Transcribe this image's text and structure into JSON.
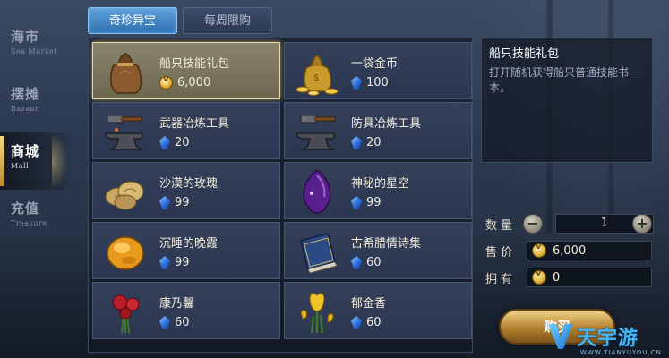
{
  "side_menu": [
    {
      "cn": "海市",
      "en": "Sea Market",
      "active": false
    },
    {
      "cn": "摆摊",
      "en": "Bazaar",
      "active": false
    },
    {
      "cn": "商城",
      "en": "Mall",
      "active": true
    },
    {
      "cn": "充值",
      "en": "Treasure",
      "active": false
    }
  ],
  "tabs": [
    {
      "label": "奇珍异宝",
      "active": true
    },
    {
      "label": "每周限购",
      "active": false
    }
  ],
  "items": [
    {
      "name": "船只技能礼包",
      "currency": "coin",
      "price": "6,000",
      "icon": "treasure-bag-icon",
      "selected": true
    },
    {
      "name": "一袋金币",
      "currency": "gem",
      "price": "100",
      "icon": "gold-coin-bag-icon",
      "selected": false
    },
    {
      "name": "武器冶炼工具",
      "currency": "gem",
      "price": "20",
      "icon": "anvil-hammer-icon",
      "selected": false
    },
    {
      "name": "防具冶炼工具",
      "currency": "gem",
      "price": "20",
      "icon": "anvil-hammer-icon",
      "selected": false
    },
    {
      "name": "沙漠的玫瑰",
      "currency": "gem",
      "price": "99",
      "icon": "desert-rose-icon",
      "selected": false
    },
    {
      "name": "神秘的星空",
      "currency": "gem",
      "price": "99",
      "icon": "purple-gem-icon",
      "selected": false
    },
    {
      "name": "沉睡的晚霞",
      "currency": "gem",
      "price": "99",
      "icon": "amber-stone-icon",
      "selected": false
    },
    {
      "name": "古希腊情诗集",
      "currency": "gem",
      "price": "60",
      "icon": "book-icon",
      "selected": false
    },
    {
      "name": "康乃馨",
      "currency": "gem",
      "price": "60",
      "icon": "carnation-icon",
      "selected": false
    },
    {
      "name": "郁金香",
      "currency": "gem",
      "price": "60",
      "icon": "tulip-icon",
      "selected": false
    }
  ],
  "detail": {
    "title": "船只技能礼包",
    "description": "打开随机获得船只普通技能书一本。"
  },
  "stats": {
    "quantity_label": "数量",
    "quantity_value": "1",
    "price_label": "售价",
    "price_value": "6,000",
    "owned_label": "拥有",
    "owned_value": "0"
  },
  "buy_button": {
    "label": "购买"
  },
  "watermark": {
    "text": "天宇游",
    "sub": "WWW.TIANYUYOU.CN"
  },
  "colors": {
    "tab_active": "#3f86c8",
    "selected_card_border": "#e9dca0",
    "gem": "#2d6ee0",
    "coin": "#e2b640"
  }
}
